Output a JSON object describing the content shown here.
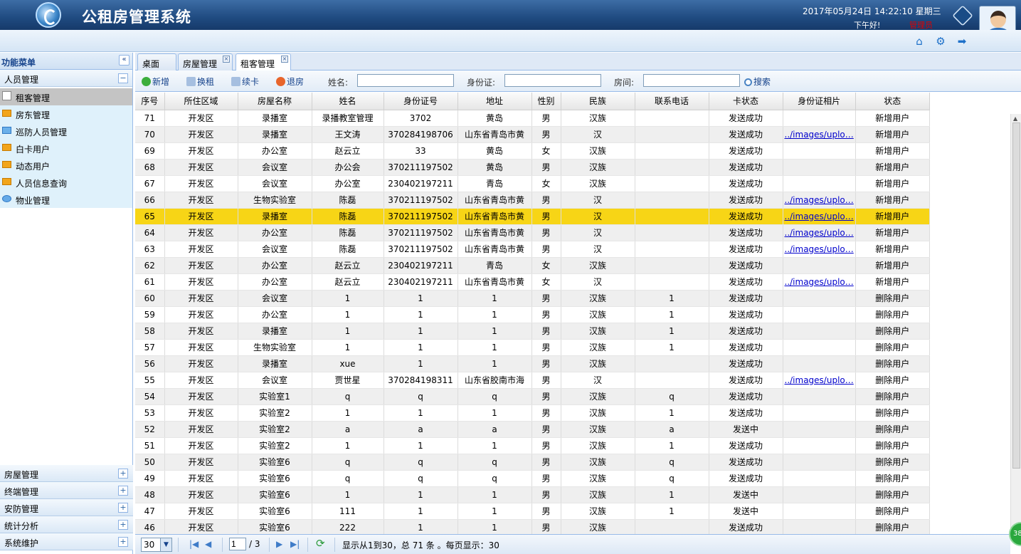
{
  "header": {
    "title": "公租房管理系统",
    "datetime": "2017年05月24日 14:22:10 星期三",
    "greeting": "下午好!",
    "role": "管理员"
  },
  "sidebar": {
    "title": "功能菜单",
    "collapse_label": "«",
    "group": {
      "label": "人员管理",
      "toggle": "−"
    },
    "items": [
      {
        "label": "租客管理"
      },
      {
        "label": "房东管理"
      },
      {
        "label": "巡防人员管理"
      },
      {
        "label": "白卡用户"
      },
      {
        "label": "动态用户"
      },
      {
        "label": "人员信息查询"
      },
      {
        "label": "物业管理"
      }
    ],
    "bottom_groups": [
      {
        "label": "房屋管理"
      },
      {
        "label": "终端管理"
      },
      {
        "label": "安防管理"
      },
      {
        "label": "统计分析"
      },
      {
        "label": "系统维护"
      }
    ],
    "plus": "+"
  },
  "tabs": [
    {
      "label": "桌面"
    },
    {
      "label": "房屋管理",
      "close": "×"
    },
    {
      "label": "租客管理",
      "close": "×"
    }
  ],
  "actions": {
    "add": "新增",
    "change": "换租",
    "renew": "续卡",
    "return": "退房",
    "search": "搜索"
  },
  "filters": {
    "name": "姓名:",
    "idcard": "身份证:",
    "room": "房间:"
  },
  "table": {
    "columns": [
      "序号",
      "所住区域",
      "房屋名称",
      "姓名",
      "身份证号",
      "地址",
      "性别",
      "民族",
      "联系电话",
      "卡状态",
      "身份证相片",
      "状态"
    ],
    "rows": [
      [
        "71",
        "开发区",
        "录播室",
        "录播教室管理",
        "3702",
        "黄岛",
        "男",
        "汉族",
        "",
        "发送成功",
        "",
        "新增用户"
      ],
      [
        "70",
        "开发区",
        "录播室",
        "王文涛",
        "370284198706",
        "山东省青岛市黄",
        "男",
        "汉",
        "",
        "发送成功",
        "../images/uplo…",
        "新增用户"
      ],
      [
        "69",
        "开发区",
        "办公室",
        "赵云立",
        "33",
        "黄岛",
        "女",
        "汉族",
        "",
        "发送成功",
        "",
        "新增用户"
      ],
      [
        "68",
        "开发区",
        "会议室",
        "办公会",
        "370211197502",
        "黄岛",
        "男",
        "汉族",
        "",
        "发送成功",
        "",
        "新增用户"
      ],
      [
        "67",
        "开发区",
        "会议室",
        "办公室",
        "230402197211",
        "青岛",
        "女",
        "汉族",
        "",
        "发送成功",
        "",
        "新增用户"
      ],
      [
        "66",
        "开发区",
        "生物实验室",
        "陈磊",
        "370211197502",
        "山东省青岛市黄",
        "男",
        "汉",
        "",
        "发送成功",
        "../images/uplo…",
        "新增用户"
      ],
      [
        "65",
        "开发区",
        "录播室",
        "陈磊",
        "370211197502",
        "山东省青岛市黄",
        "男",
        "汉",
        "",
        "发送成功",
        "../images/uplo…",
        "新增用户"
      ],
      [
        "64",
        "开发区",
        "办公室",
        "陈磊",
        "370211197502",
        "山东省青岛市黄",
        "男",
        "汉",
        "",
        "发送成功",
        "../images/uplo…",
        "新增用户"
      ],
      [
        "63",
        "开发区",
        "会议室",
        "陈磊",
        "370211197502",
        "山东省青岛市黄",
        "男",
        "汉",
        "",
        "发送成功",
        "../images/uplo…",
        "新增用户"
      ],
      [
        "62",
        "开发区",
        "办公室",
        "赵云立",
        "230402197211",
        "青岛",
        "女",
        "汉族",
        "",
        "发送成功",
        "",
        "新增用户"
      ],
      [
        "61",
        "开发区",
        "办公室",
        "赵云立",
        "230402197211",
        "山东省青岛市黄",
        "女",
        "汉",
        "",
        "发送成功",
        "../images/uplo…",
        "新增用户"
      ],
      [
        "60",
        "开发区",
        "会议室",
        "1",
        "1",
        "1",
        "男",
        "汉族",
        "1",
        "发送成功",
        "",
        "删除用户"
      ],
      [
        "59",
        "开发区",
        "办公室",
        "1",
        "1",
        "1",
        "男",
        "汉族",
        "1",
        "发送成功",
        "",
        "删除用户"
      ],
      [
        "58",
        "开发区",
        "录播室",
        "1",
        "1",
        "1",
        "男",
        "汉族",
        "1",
        "发送成功",
        "",
        "删除用户"
      ],
      [
        "57",
        "开发区",
        "生物实验室",
        "1",
        "1",
        "1",
        "男",
        "汉族",
        "1",
        "发送成功",
        "",
        "删除用户"
      ],
      [
        "56",
        "开发区",
        "录播室",
        "xue",
        "1",
        "1",
        "男",
        "汉族",
        "",
        "发送成功",
        "",
        "删除用户"
      ],
      [
        "55",
        "开发区",
        "会议室",
        "贾世星",
        "370284198311",
        "山东省胶南市海",
        "男",
        "汉",
        "",
        "发送成功",
        "../images/uplo…",
        "删除用户"
      ],
      [
        "54",
        "开发区",
        "实验室1",
        "q",
        "q",
        "q",
        "男",
        "汉族",
        "q",
        "发送成功",
        "",
        "删除用户"
      ],
      [
        "53",
        "开发区",
        "实验室2",
        "1",
        "1",
        "1",
        "男",
        "汉族",
        "1",
        "发送成功",
        "",
        "删除用户"
      ],
      [
        "52",
        "开发区",
        "实验室2",
        "a",
        "a",
        "a",
        "男",
        "汉族",
        "a",
        "发送中",
        "",
        "删除用户"
      ],
      [
        "51",
        "开发区",
        "实验室2",
        "1",
        "1",
        "1",
        "男",
        "汉族",
        "1",
        "发送成功",
        "",
        "删除用户"
      ],
      [
        "50",
        "开发区",
        "实验室6",
        "q",
        "q",
        "q",
        "男",
        "汉族",
        "q",
        "发送成功",
        "",
        "删除用户"
      ],
      [
        "49",
        "开发区",
        "实验室6",
        "q",
        "q",
        "q",
        "男",
        "汉族",
        "q",
        "发送成功",
        "",
        "删除用户"
      ],
      [
        "48",
        "开发区",
        "实验室6",
        "1",
        "1",
        "1",
        "男",
        "汉族",
        "1",
        "发送中",
        "",
        "删除用户"
      ],
      [
        "47",
        "开发区",
        "实验室6",
        "111",
        "1",
        "1",
        "男",
        "汉族",
        "1",
        "发送中",
        "",
        "删除用户"
      ],
      [
        "46",
        "开发区",
        "实验室6",
        "222",
        "1",
        "1",
        "男",
        "汉族",
        "",
        "发送成功",
        "",
        "删除用户"
      ]
    ],
    "highlight_row": "65"
  },
  "pager": {
    "page_size": "30",
    "page": "1",
    "total_pages": "/ 3",
    "info": "显示从1到30，总 71 条 。每页显示：30"
  },
  "badge": "38",
  "colors": {
    "header": "#1f4a80",
    "highlight": "#f7d516",
    "link": "#0000cc"
  }
}
